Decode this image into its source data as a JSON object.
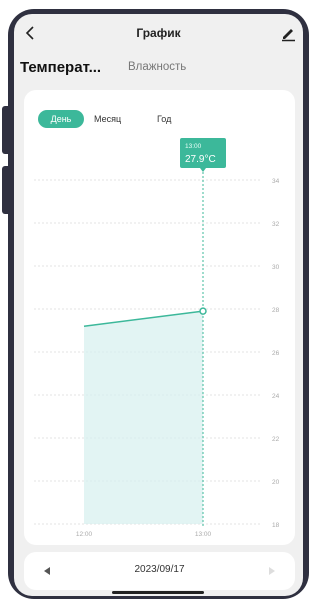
{
  "nav": {
    "title": "График"
  },
  "tabs": {
    "active": "Температ...",
    "inactive": "Влажность"
  },
  "period": {
    "day": "День",
    "month": "Месяц",
    "year": "Год"
  },
  "pager": {
    "date": "2023/09/17"
  },
  "colors": {
    "accent": "#3cb89a",
    "area": "#d8f0ef",
    "frame": "#2f3040"
  },
  "chart_data": {
    "type": "area",
    "x": [
      "12:00",
      "13:00"
    ],
    "values": [
      27.2,
      27.9
    ],
    "ylim": [
      18,
      34
    ],
    "y_ticks": [
      "34",
      "32",
      "30",
      "28",
      "26",
      "24",
      "22",
      "20",
      "18"
    ],
    "tooltip": {
      "time": "13:00",
      "value": "27.9°C"
    }
  }
}
